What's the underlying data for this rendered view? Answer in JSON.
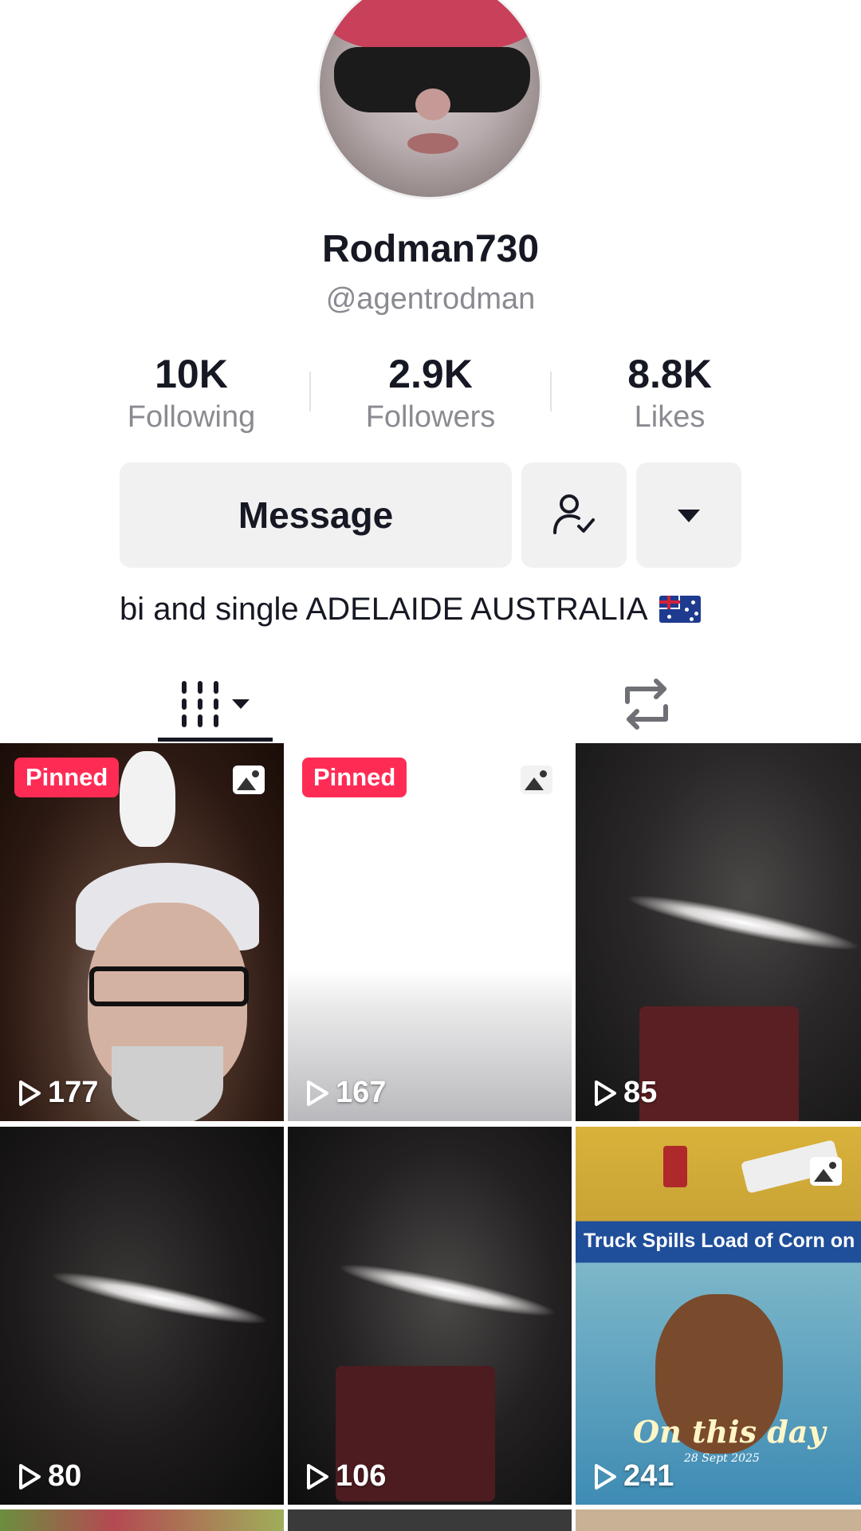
{
  "profile": {
    "display_name": "Rodman730",
    "username": "@agentrodman",
    "bio": "bi and single ADELAIDE AUSTRALIA",
    "bio_flag": "australia-flag"
  },
  "stats": [
    {
      "value": "10K",
      "label": "Following"
    },
    {
      "value": "2.9K",
      "label": "Followers"
    },
    {
      "value": "8.8K",
      "label": "Likes"
    }
  ],
  "actions": {
    "message_label": "Message",
    "following_icon": "person-check-icon",
    "more_icon": "caret-down-icon"
  },
  "tabs": [
    {
      "icon": "videos-grid-icon",
      "active": true
    },
    {
      "icon": "repost-icon",
      "active": false
    }
  ],
  "videos": [
    {
      "pinned_label": "Pinned",
      "views": "177",
      "photo": true
    },
    {
      "pinned_label": "Pinned",
      "views": "167",
      "photo": true
    },
    {
      "views": "85"
    },
    {
      "views": "80"
    },
    {
      "views": "106"
    },
    {
      "views": "241",
      "photo": true,
      "banner_text": "Truck Spills Load of Corn on H",
      "overlay_title": "On this day",
      "overlay_date": "28 Sept 2025"
    }
  ],
  "colors": {
    "pinned_badge": "#fe2c55",
    "secondary_text": "#8a8b91",
    "button_bg": "#f1f1f2"
  }
}
